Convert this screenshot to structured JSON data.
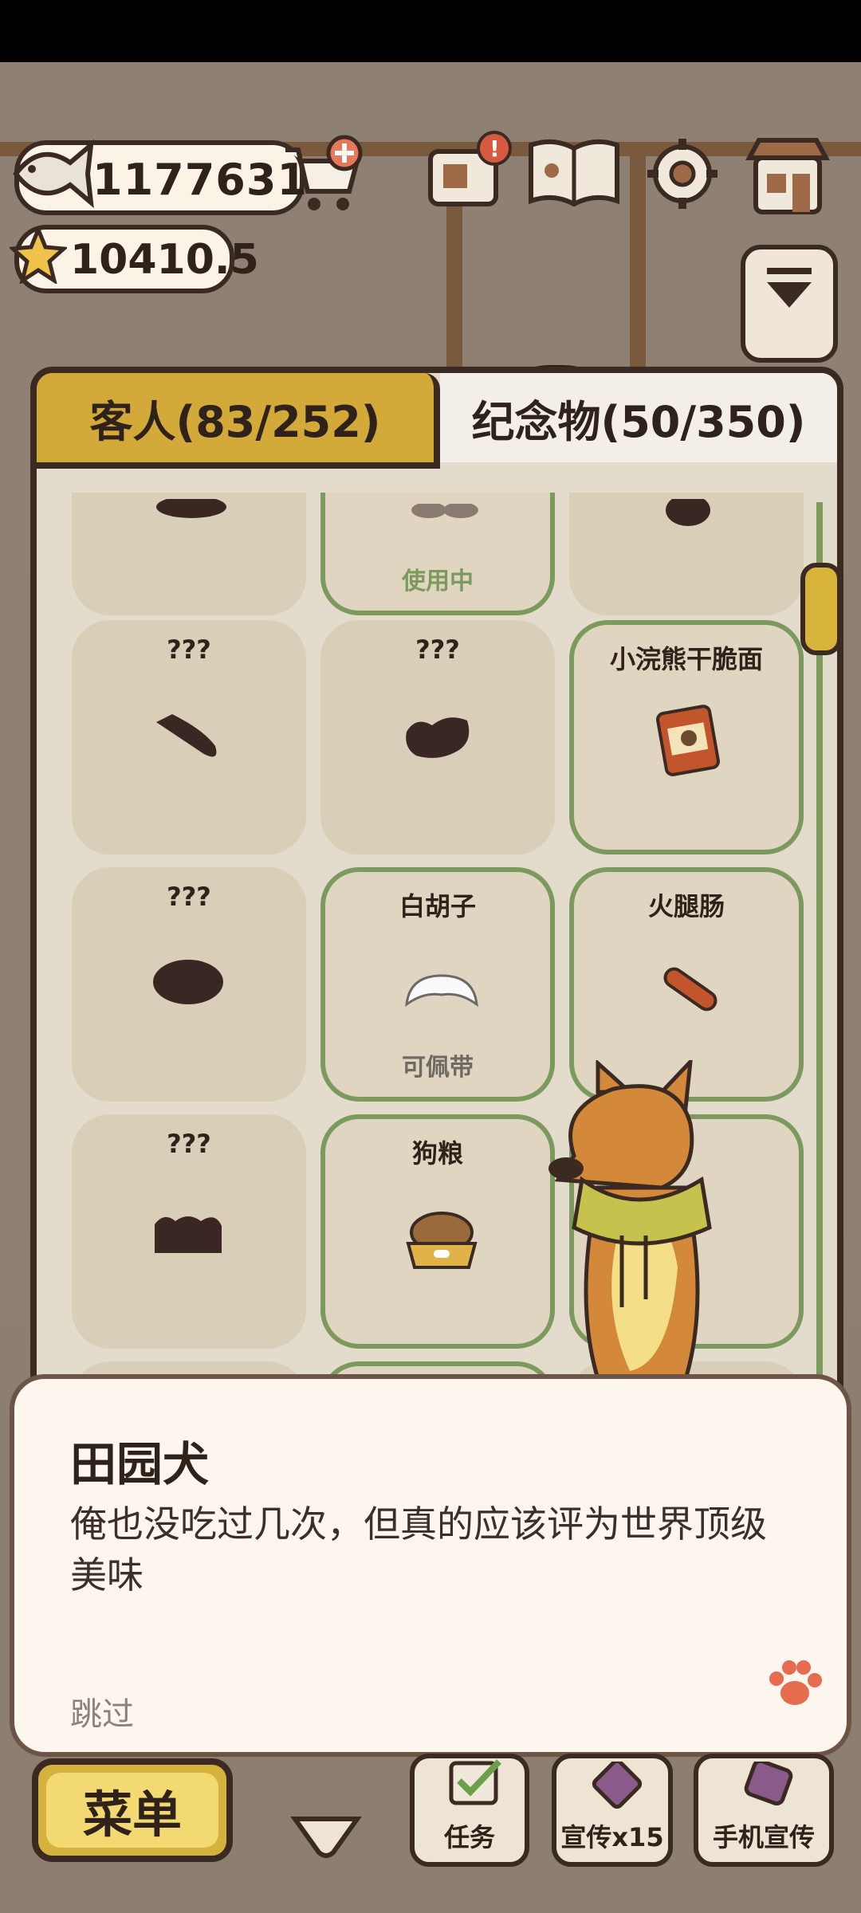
{
  "currency": {
    "fish": "1177631",
    "stars": "10410.5"
  },
  "tabs": [
    {
      "label": "客人(83/252)",
      "active": false
    },
    {
      "label": "纪念物(50/350)",
      "active": true
    }
  ],
  "grid": {
    "row0": [
      {
        "title": "",
        "sub": ""
      },
      {
        "title": "",
        "sub": "使用中"
      },
      {
        "title": "",
        "sub": ""
      }
    ],
    "row1": [
      {
        "title": "???",
        "sub": ""
      },
      {
        "title": "???",
        "sub": ""
      },
      {
        "title": "小浣熊干脆面",
        "sub": ""
      }
    ],
    "row2": [
      {
        "title": "???",
        "sub": ""
      },
      {
        "title": "白胡子",
        "sub": "可佩带"
      },
      {
        "title": "火腿肠",
        "sub": ""
      }
    ],
    "row3": [
      {
        "title": "???",
        "sub": ""
      },
      {
        "title": "狗粮",
        "sub": ""
      },
      {
        "title": "",
        "sub": ""
      }
    ]
  },
  "dialog": {
    "speaker": "田园犬",
    "text": "俺也没吃过几次，但真的应该评为世界顶级美味",
    "skip": "跳过"
  },
  "bottom_bar": {
    "menu": "菜单",
    "tasks": "任务",
    "promote": "宣传x15",
    "phone_promote": "手机宣传"
  },
  "colors": {
    "accent": "#d3a93a",
    "owned_border": "#7d9a5e",
    "outline": "#3b2a22"
  },
  "icons": [
    "fish-icon",
    "cart-plus-icon",
    "star-icon",
    "letter-icon",
    "book-icon",
    "gear-icon",
    "shop-icon",
    "paw-icon"
  ]
}
